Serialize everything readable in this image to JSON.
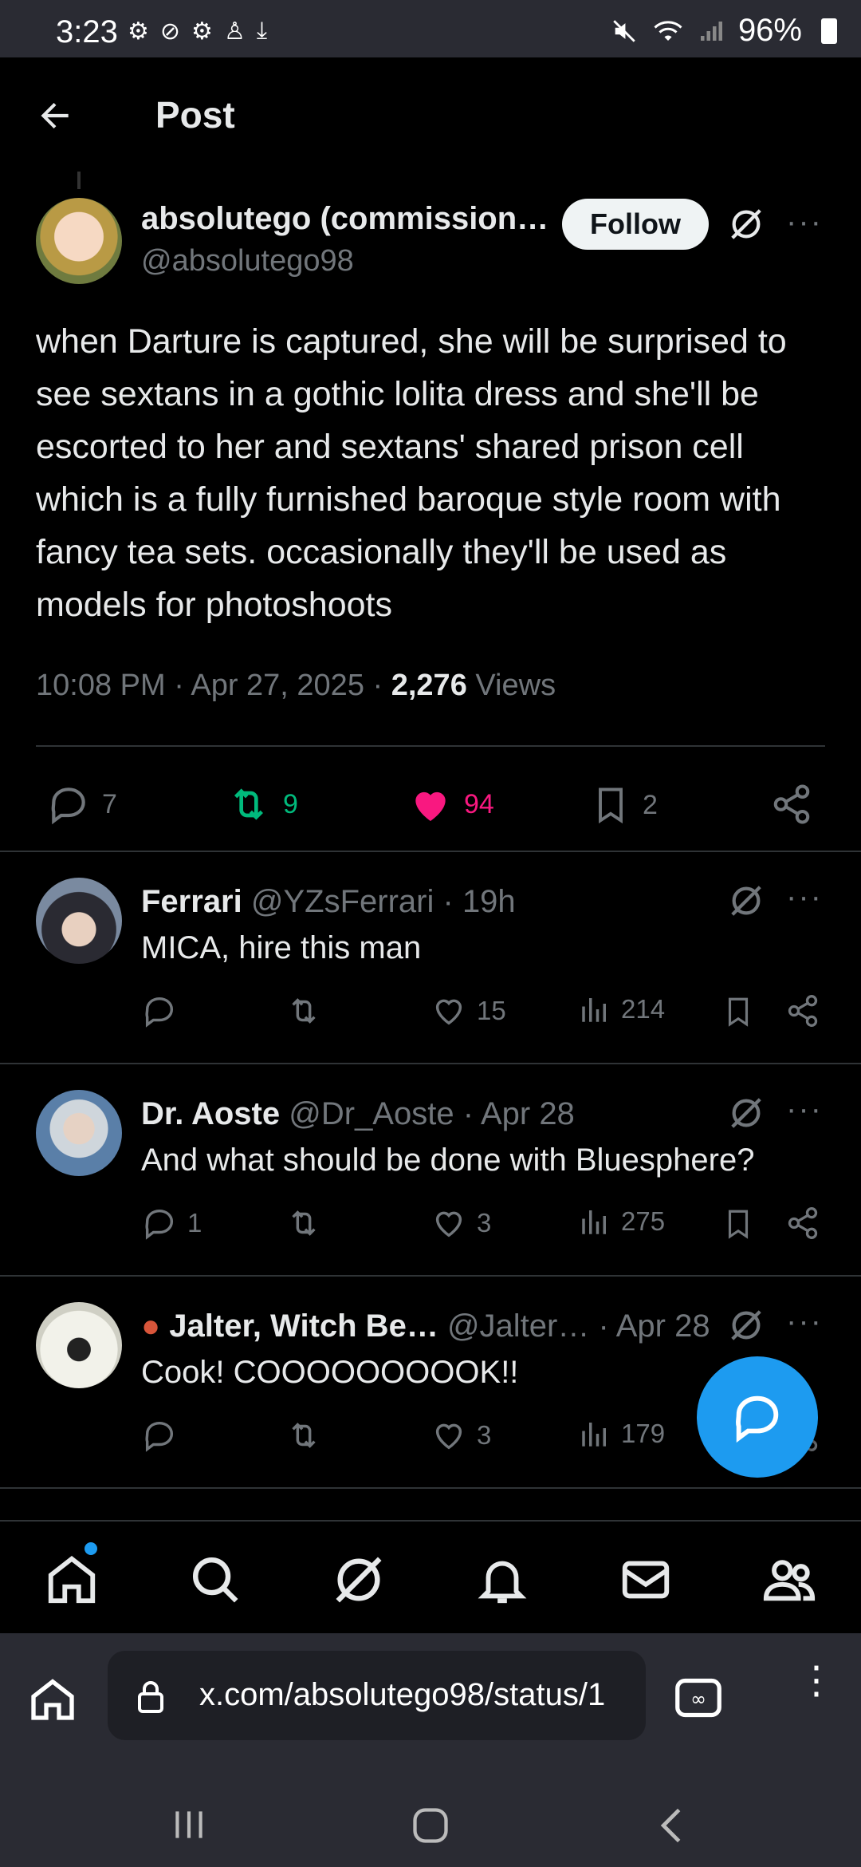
{
  "status_bar": {
    "time": "3:23",
    "battery": "96%"
  },
  "header": {
    "title": "Post"
  },
  "post": {
    "author_name": "absolutego (commission…",
    "author_handle": "@absolutego98",
    "follow_label": "Follow",
    "text": "when Darture is captured, she will be surprised to see sextans in a gothic lolita dress and she'll be escorted to her and sextans' shared prison cell which is a fully furnished baroque style room with fancy tea sets. occasionally they'll be used as models for photoshoots",
    "time": "10:08 PM",
    "date": "Apr 27, 2025",
    "views_count": "2,276",
    "views_label": "Views",
    "replies": "7",
    "reposts": "9",
    "likes": "94",
    "bookmarks": "2"
  },
  "replies": [
    {
      "name": "Ferrari",
      "handle": "@YZsFerrari",
      "time": "19h",
      "text": "MICA, hire this man",
      "reply_count": "",
      "repost_count": "",
      "like_count": "15",
      "view_count": "214"
    },
    {
      "name": "Dr. Aoste",
      "handle": "@Dr_Aoste",
      "time": "Apr 28",
      "text": "And what should be done with Bluesphere?",
      "reply_count": "1",
      "repost_count": "",
      "like_count": "3",
      "view_count": "275"
    },
    {
      "name": "Jalter, Witch Be…",
      "handle": "@Jalter…",
      "time": "Apr 28",
      "text": "Cook! COOOOOOOOOK!!",
      "reply_count": "",
      "repost_count": "",
      "like_count": "3",
      "view_count": "179"
    }
  ],
  "browser": {
    "url": "x.com/absolutego98/status/1"
  },
  "colors": {
    "accent": "#1d9bf0",
    "like": "#f91880",
    "repost": "#00ba7c",
    "muted": "#71767b"
  }
}
